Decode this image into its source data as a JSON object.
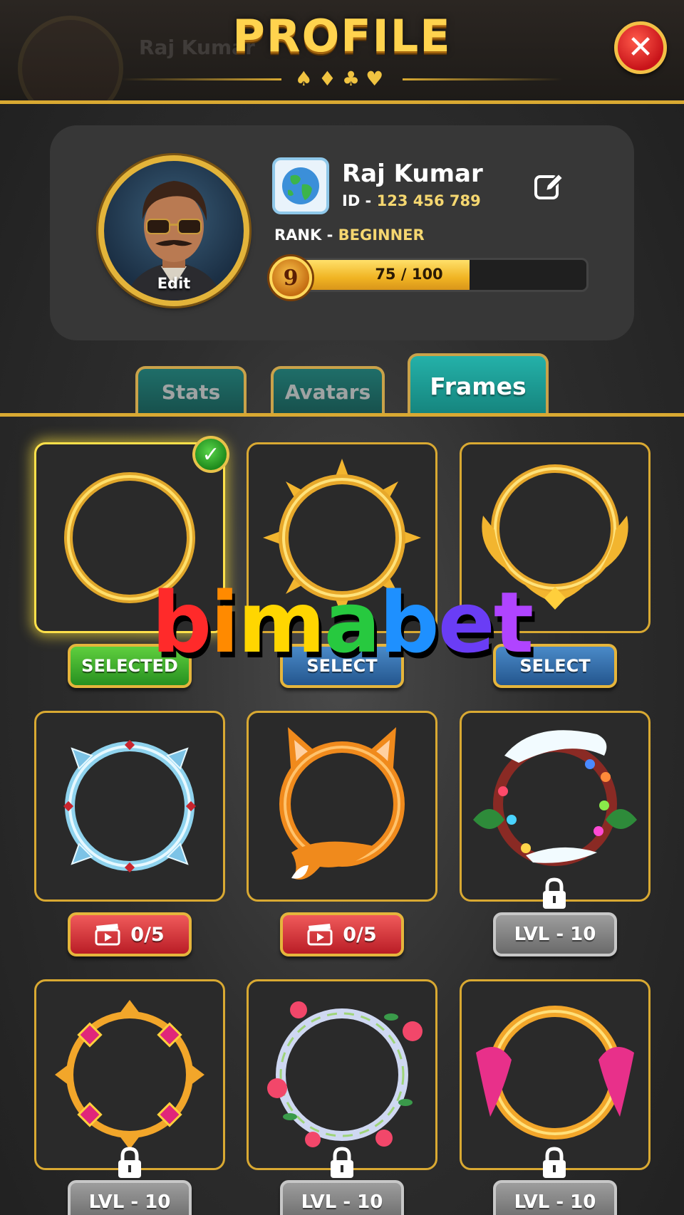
{
  "header": {
    "title": "PROFILE",
    "suits": "♠♦♣♥",
    "close_icon": "close-icon",
    "background_name": "Raj Kumar"
  },
  "profile": {
    "name": "Raj Kumar",
    "id_label": "ID - ",
    "id_value": "123 456 789",
    "rank_label": "RANK - ",
    "rank_value": "BEGINNER",
    "avatar_edit_label": "Edit",
    "level": "9",
    "xp_text": "75 / 100",
    "xp_current": 75,
    "xp_max": 100,
    "country_icon": "globe-icon",
    "edit_icon": "edit-pencil-icon"
  },
  "tabs": [
    {
      "label": "Stats",
      "active": false
    },
    {
      "label": "Avatars",
      "active": false
    },
    {
      "label": "Frames",
      "active": true
    }
  ],
  "frames": [
    {
      "name": "plain-gold-ring",
      "button": "SELECTED",
      "button_style": "green",
      "selected": true,
      "locked": false
    },
    {
      "name": "sun-spike-ring",
      "button": "SELECT",
      "button_style": "blue",
      "selected": false,
      "locked": false
    },
    {
      "name": "royal-crest-ring",
      "button": "SELECT",
      "button_style": "blue",
      "selected": false,
      "locked": false
    },
    {
      "name": "ice-crystal-frame",
      "button": "0/5",
      "button_style": "red",
      "button_icon": "video-clapper-icon",
      "selected": false,
      "locked": false
    },
    {
      "name": "fox-ear-frame",
      "button": "0/5",
      "button_style": "red",
      "button_icon": "video-clapper-icon",
      "selected": false,
      "locked": false
    },
    {
      "name": "christmas-wreath-frame",
      "button": "LVL - 10",
      "button_style": "gray",
      "selected": false,
      "locked": true
    },
    {
      "name": "ruby-jewel-frame",
      "button": "LVL - 10",
      "button_style": "gray",
      "selected": false,
      "locked": true
    },
    {
      "name": "flower-vine-frame",
      "button": "LVL - 10",
      "button_style": "gray",
      "selected": false,
      "locked": true
    },
    {
      "name": "pink-ribbon-frame",
      "button": "LVL - 10",
      "button_style": "gray",
      "selected": false,
      "locked": true
    }
  ],
  "watermark": {
    "text": "bimabet",
    "letters": [
      "b",
      "i",
      "m",
      "a",
      "b",
      "e",
      "t"
    ],
    "colors": [
      "#ff2a2a",
      "#ff8a00",
      "#ffd600",
      "#27c93f",
      "#1e90ff",
      "#6a3df5",
      "#b044ff"
    ]
  },
  "colors": {
    "accent_gold": "#d9a932",
    "tab_active": "#1fa39b",
    "panel": "#373737"
  }
}
